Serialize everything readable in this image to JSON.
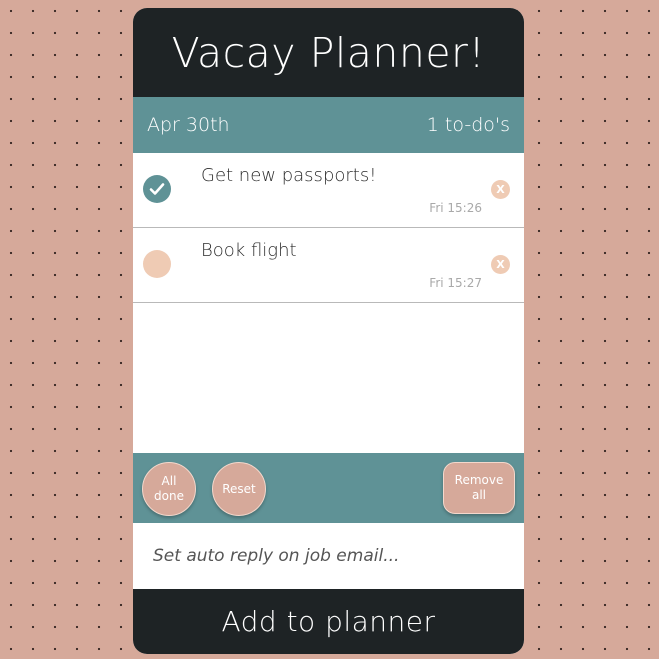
{
  "app": {
    "title": "Vacay Planner!"
  },
  "subbar": {
    "date": "Apr 30th",
    "count": "1 to-do's"
  },
  "todos": [
    {
      "text": "Get new passports!",
      "time": "Fri 15:26",
      "done": true,
      "delete_label": "X"
    },
    {
      "text": "Book flight",
      "time": "Fri 15:27",
      "done": false,
      "delete_label": "X"
    }
  ],
  "actions": {
    "all_done": "All\ndone",
    "reset": "Reset",
    "remove_all": "Remove\nall"
  },
  "input": {
    "placeholder": "Set auto reply on job email...",
    "value": ""
  },
  "footer": {
    "add_label": "Add to planner"
  },
  "colors": {
    "background": "#d6a99a",
    "dark": "#1e2325",
    "teal": "#5f9296",
    "peach": "#efcbb4"
  }
}
